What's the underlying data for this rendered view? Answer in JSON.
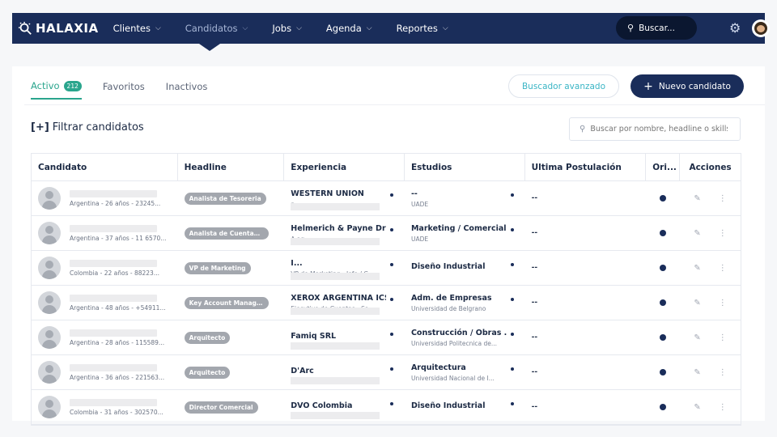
{
  "app": {
    "brand": "HALAXIA"
  },
  "nav": [
    {
      "label": "Clientes",
      "active": false
    },
    {
      "label": "Candidatos",
      "active": true
    },
    {
      "label": "Jobs",
      "active": false
    },
    {
      "label": "Agenda",
      "active": false
    },
    {
      "label": "Reportes",
      "active": false
    }
  ],
  "topsearch": {
    "label": "Buscar..."
  },
  "tabs": [
    {
      "label": "Activo",
      "badge": "212"
    },
    {
      "label": "Favoritos"
    },
    {
      "label": "Inactivos"
    }
  ],
  "actions": {
    "advanced": "Buscador avanzado",
    "new_candidate": "Nuevo candidato"
  },
  "filter": {
    "bracket": "[+]",
    "label": "Filtrar candidatos"
  },
  "search": {
    "placeholder": "Buscar por nombre, headline o skills"
  },
  "table": {
    "headers": [
      "Candidato",
      "Headline",
      "Experiencia",
      "Estudios",
      "Ultima Postulación",
      "Ori...",
      "Acciones"
    ],
    "rows": [
      {
        "meta": "Argentina - 26 años - 23245...",
        "headline": "Analista de Tesoreria",
        "exp_title": "WESTERN UNIÓN",
        "exp_sub": "n...",
        "edu_title": "--",
        "edu_sub": "UADE",
        "last": "--"
      },
      {
        "meta": "Argentina - 37 años - 11 6570...",
        "headline": "Analista de Cuentas ...",
        "exp_title": "Helmerich & Payne Dri...",
        "exp_sub": "A                              ag...",
        "edu_title": "Marketing / Comercial...",
        "edu_sub": "UADE",
        "last": "--"
      },
      {
        "meta": "Colombia - 22 años - 88223...",
        "headline": "VP de Marketing",
        "exp_title": "I...",
        "exp_sub": "VP de Marketing - Jefe / C...",
        "edu_title": "Diseño Industrial",
        "edu_sub": "",
        "last": "--"
      },
      {
        "meta": "Argentina - 48 años - +54911...",
        "headline": "Key Account Manager",
        "exp_title": "XEROX ARGENTINA ICSA",
        "exp_sub": "Ejecutivo de Cuentas - Sa...",
        "edu_title": "Adm. de Empresas",
        "edu_sub": "Universidad de Belgrano",
        "last": "--"
      },
      {
        "meta": "Argentina - 28 años - 115589...",
        "headline": "Arquitecto",
        "exp_title": "Famiq SRL",
        "exp_sub": "",
        "edu_title": "Construcción / Obras ...",
        "edu_sub": "Universidad Politecnica de...",
        "last": "--"
      },
      {
        "meta": "Argentina - 36 años - 221563...",
        "headline": "Arquitecto",
        "exp_title": "D'Arc",
        "exp_sub": "",
        "edu_title": "Arquitectura",
        "edu_sub": "Universidad Nacional de I...",
        "last": "--"
      },
      {
        "meta": "Colombia - 31 años - 302570...",
        "headline": "Director Comercial",
        "exp_title": "DVO Colombia",
        "exp_sub": "",
        "edu_title": "Diseño Industrial",
        "edu_sub": "",
        "last": "--"
      }
    ]
  },
  "colors": {
    "navy": "#1a2d5a",
    "teal": "#2aa58d",
    "cyan": "#3ab5c5",
    "pill": "#a3a7ae"
  }
}
